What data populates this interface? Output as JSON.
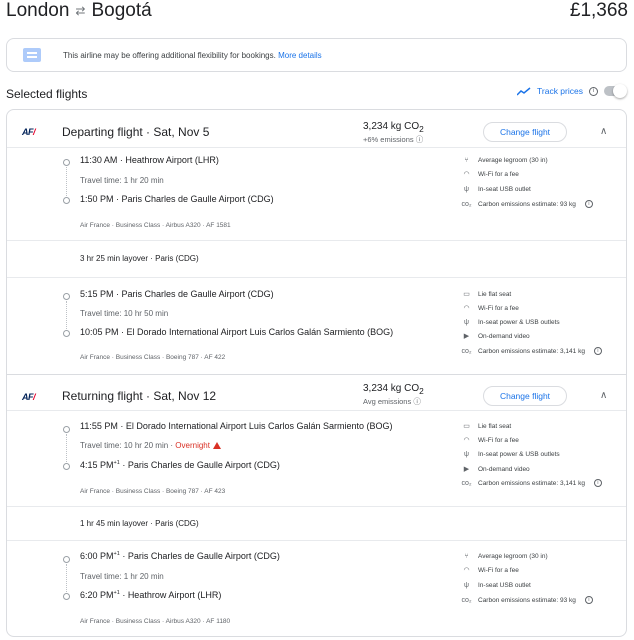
{
  "header": {
    "origin": "London",
    "destination": "Bogotá",
    "price": "£1,368"
  },
  "notice": {
    "text": "This airline may be offering additional flexibility for bookings.",
    "link": "More details"
  },
  "selected_title": "Selected flights",
  "track_prices": "Track prices",
  "change_label": "Change flight",
  "departing": {
    "title": "Departing flight · Sat, Nov 5",
    "co2": "3,234 kg CO",
    "co2_sub": "2",
    "co2_note": "+6% emissions",
    "seg1": {
      "dep_time": "11:30 AM",
      "dep_airport": "Heathrow Airport (LHR)",
      "travel": "Travel time: 1 hr 20 min",
      "arr_time": "1:50 PM",
      "arr_airport": "Paris Charles de Gaulle Airport (CDG)",
      "meta": "Air France · Business Class · Airbus A320 · AF 1581",
      "features": [
        "Average legroom (30 in)",
        "Wi-Fi for a fee",
        "In-seat USB outlet",
        "Carbon emissions estimate: 93 kg"
      ]
    },
    "layover": "3 hr 25 min layover · Paris (CDG)",
    "seg2": {
      "dep_time": "5:15 PM",
      "dep_airport": "Paris Charles de Gaulle Airport (CDG)",
      "travel": "Travel time: 10 hr 50 min",
      "arr_time": "10:05 PM",
      "arr_airport": "El Dorado International Airport Luis Carlos Galán Sarmiento (BOG)",
      "meta": "Air France · Business Class · Boeing 787 · AF 422",
      "features": [
        "Lie flat seat",
        "Wi-Fi for a fee",
        "In-seat power & USB outlets",
        "On-demand video",
        "Carbon emissions estimate: 3,141 kg"
      ]
    }
  },
  "returning": {
    "title": "Returning flight · Sat, Nov 12",
    "co2": "3,234 kg CO",
    "co2_sub": "2",
    "co2_note": "Avg emissions",
    "seg1": {
      "dep_time": "11:55 PM",
      "dep_airport": "El Dorado International Airport Luis Carlos Galán Sarmiento (BOG)",
      "travel": "Travel time: 10 hr 20 min · ",
      "overnight": "Overnight",
      "arr_time": "4:15 PM",
      "arr_sup": "+1",
      "arr_airport": "Paris Charles de Gaulle Airport (CDG)",
      "meta": "Air France · Business Class · Boeing 787 · AF 423",
      "features": [
        "Lie flat seat",
        "Wi-Fi for a fee",
        "In-seat power & USB outlets",
        "On-demand video",
        "Carbon emissions estimate: 3,141 kg"
      ]
    },
    "layover": "1 hr 45 min layover · Paris (CDG)",
    "seg2": {
      "dep_time": "6:00 PM",
      "dep_sup": "+1",
      "dep_airport": "Paris Charles de Gaulle Airport (CDG)",
      "travel": "Travel time: 1 hr 20 min",
      "arr_time": "6:20 PM",
      "arr_sup": "+1",
      "arr_airport": "Heathrow Airport (LHR)",
      "meta": "Air France · Business Class · Airbus A320 · AF 1180",
      "features": [
        "Average legroom (30 in)",
        "Wi-Fi for a fee",
        "In-seat USB outlet",
        "Carbon emissions estimate: 93 kg"
      ]
    }
  },
  "airline_logo": {
    "text": "AF",
    "slash": "/"
  },
  "colors": {
    "link": "#1a73e8",
    "warning": "#d93025",
    "border": "#dadce0"
  }
}
